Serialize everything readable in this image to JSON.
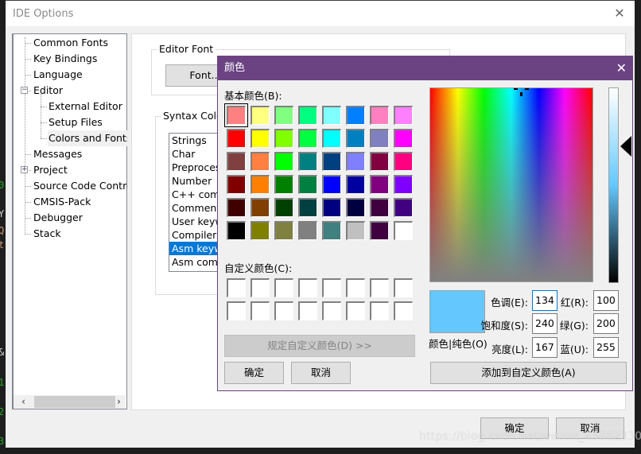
{
  "background": {
    "code_glyphs": [
      {
        "text": "0",
        "color": "#22a722"
      },
      {
        "text": "Y",
        "color": "#d4d4d4"
      },
      {
        "text": "Q",
        "color": "#ce9178"
      },
      {
        "text": "t",
        "color": "#ce9178"
      },
      {
        "text": "&",
        "color": "#d4d4d4"
      },
      {
        "text": "1",
        "color": "#22a722"
      },
      {
        "text": "2",
        "color": "#22a722"
      },
      {
        "text": "3",
        "color": "#22a722"
      }
    ]
  },
  "ide_options": {
    "title": "IDE Options",
    "close_icon": "close-icon",
    "tree": {
      "items": [
        {
          "label": "Common Fonts",
          "level": 0
        },
        {
          "label": "Key Bindings",
          "level": 0
        },
        {
          "label": "Language",
          "level": 0
        },
        {
          "label": "Editor",
          "level": 0,
          "expander": "−"
        },
        {
          "label": "External Editor",
          "level": 1
        },
        {
          "label": "Setup Files",
          "level": 1
        },
        {
          "label": "Colors and Fonts",
          "level": 1,
          "selected": true
        },
        {
          "label": "Messages",
          "level": 0
        },
        {
          "label": "Project",
          "level": 0,
          "expander": "+"
        },
        {
          "label": "Source Code Control",
          "level": 0
        },
        {
          "label": "CMSIS-Pack",
          "level": 0
        },
        {
          "label": "Debugger",
          "level": 0
        },
        {
          "label": "Stack",
          "level": 0
        }
      ],
      "scroll_left": "‹",
      "scroll_right": "›"
    },
    "editor_font": {
      "group_label": "Editor Font",
      "font_button": "Font..."
    },
    "syntax_coloring": {
      "group_label": "Syntax Coloring",
      "items": [
        "Strings",
        "Char",
        "Preprocessor",
        "Number",
        "C++ comment",
        "Comment",
        "User keyword",
        "Compiler keyword",
        "Asm keyword",
        "Asm comment"
      ],
      "selected": "Asm keyword"
    },
    "ok_button": "确定",
    "cancel_button": "取消"
  },
  "color_dialog": {
    "title": "颜色",
    "basic_colors_label": "基本颜色(B):",
    "basic_colors": [
      "#ff8080",
      "#ffff80",
      "#80ff80",
      "#00ff80",
      "#80ffff",
      "#0080ff",
      "#ff80c0",
      "#ff80ff",
      "#ff0000",
      "#ffff00",
      "#80ff00",
      "#00ff40",
      "#00ffff",
      "#0080c0",
      "#8080c0",
      "#ff00ff",
      "#804040",
      "#ff8040",
      "#00ff00",
      "#008080",
      "#004080",
      "#8080ff",
      "#800040",
      "#ff0080",
      "#800000",
      "#ff8000",
      "#008000",
      "#008040",
      "#0000ff",
      "#0000a0",
      "#800080",
      "#8000ff",
      "#400000",
      "#804000",
      "#004000",
      "#004040",
      "#000080",
      "#000040",
      "#400040",
      "#400080",
      "#000000",
      "#808000",
      "#808040",
      "#808080",
      "#408080",
      "#c0c0c0",
      "#400040",
      "#ffffff"
    ],
    "selected_basic_index": 0,
    "custom_colors_label": "自定义颜色(C):",
    "custom_colors": [
      "#ffffff",
      "#ffffff",
      "#ffffff",
      "#ffffff",
      "#ffffff",
      "#ffffff",
      "#ffffff",
      "#ffffff",
      "#ffffff",
      "#ffffff",
      "#ffffff",
      "#ffffff",
      "#ffffff",
      "#ffffff",
      "#ffffff",
      "#ffffff"
    ],
    "define_custom_button": "规定自定义颜色(D) >>",
    "ok_button": "确定",
    "cancel_button": "取消",
    "preview_color": "#64c8ff",
    "preview_label": "颜色|纯色(O)",
    "fields": {
      "hue": {
        "label": "色调(E):",
        "value": "134"
      },
      "sat": {
        "label": "饱和度(S):",
        "value": "240"
      },
      "lum": {
        "label": "亮度(L):",
        "value": "167"
      },
      "red": {
        "label": "红(R):",
        "value": "100"
      },
      "green": {
        "label": "绿(G):",
        "value": "200"
      },
      "blue": {
        "label": "蓝(U):",
        "value": "255"
      }
    },
    "luminance_fraction": 0.7,
    "add_custom_button": "添加到自定义颜色(A)"
  },
  "watermark": "https://blog.csdn.net/weixin_43862330"
}
